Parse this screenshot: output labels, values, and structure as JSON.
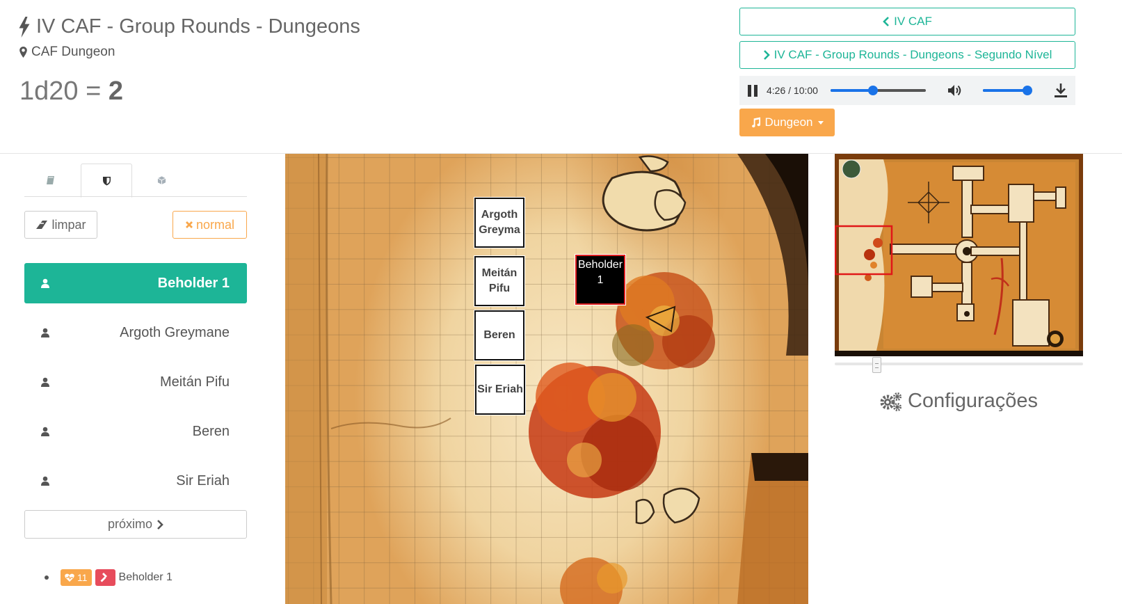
{
  "header": {
    "title": "IV CAF - Group Rounds - Dungeons",
    "location": "CAF Dungeon",
    "dice_expr": "1d20 = ",
    "dice_result": "2"
  },
  "nav": {
    "prev_label": "IV CAF",
    "next_label": "IV CAF - Group Rounds - Dungeons - Segundo Nível"
  },
  "audio": {
    "time": "4:26 / 10:00",
    "progress": 0.443,
    "volume": 0.92
  },
  "music": {
    "label": "Dungeon"
  },
  "tabs": [
    "book-icon",
    "shield-icon",
    "cube-icon"
  ],
  "actions": {
    "clear_label": "limpar",
    "mode_label": "normal"
  },
  "initiative": [
    {
      "name": "Beholder 1",
      "active": true
    },
    {
      "name": "Argoth Greymane",
      "active": false
    },
    {
      "name": "Meitán Pifu",
      "active": false
    },
    {
      "name": "Beren",
      "active": false
    },
    {
      "name": "Sir Eriah",
      "active": false
    }
  ],
  "next_label": "próximo",
  "status": {
    "hp": "11",
    "name": "Beholder 1"
  },
  "tokens": {
    "argoth": "Argoth Greyma",
    "meitan": "Meitán Pifu",
    "beren": "Beren",
    "sir_eriah": "Sir Eriah",
    "beholder": "Beholder 1"
  },
  "config_label": "Configurações",
  "colors": {
    "teal": "#1db597",
    "orange": "#f9a74b",
    "red": "#e74c5c",
    "audio_blue": "#1a73e8"
  }
}
